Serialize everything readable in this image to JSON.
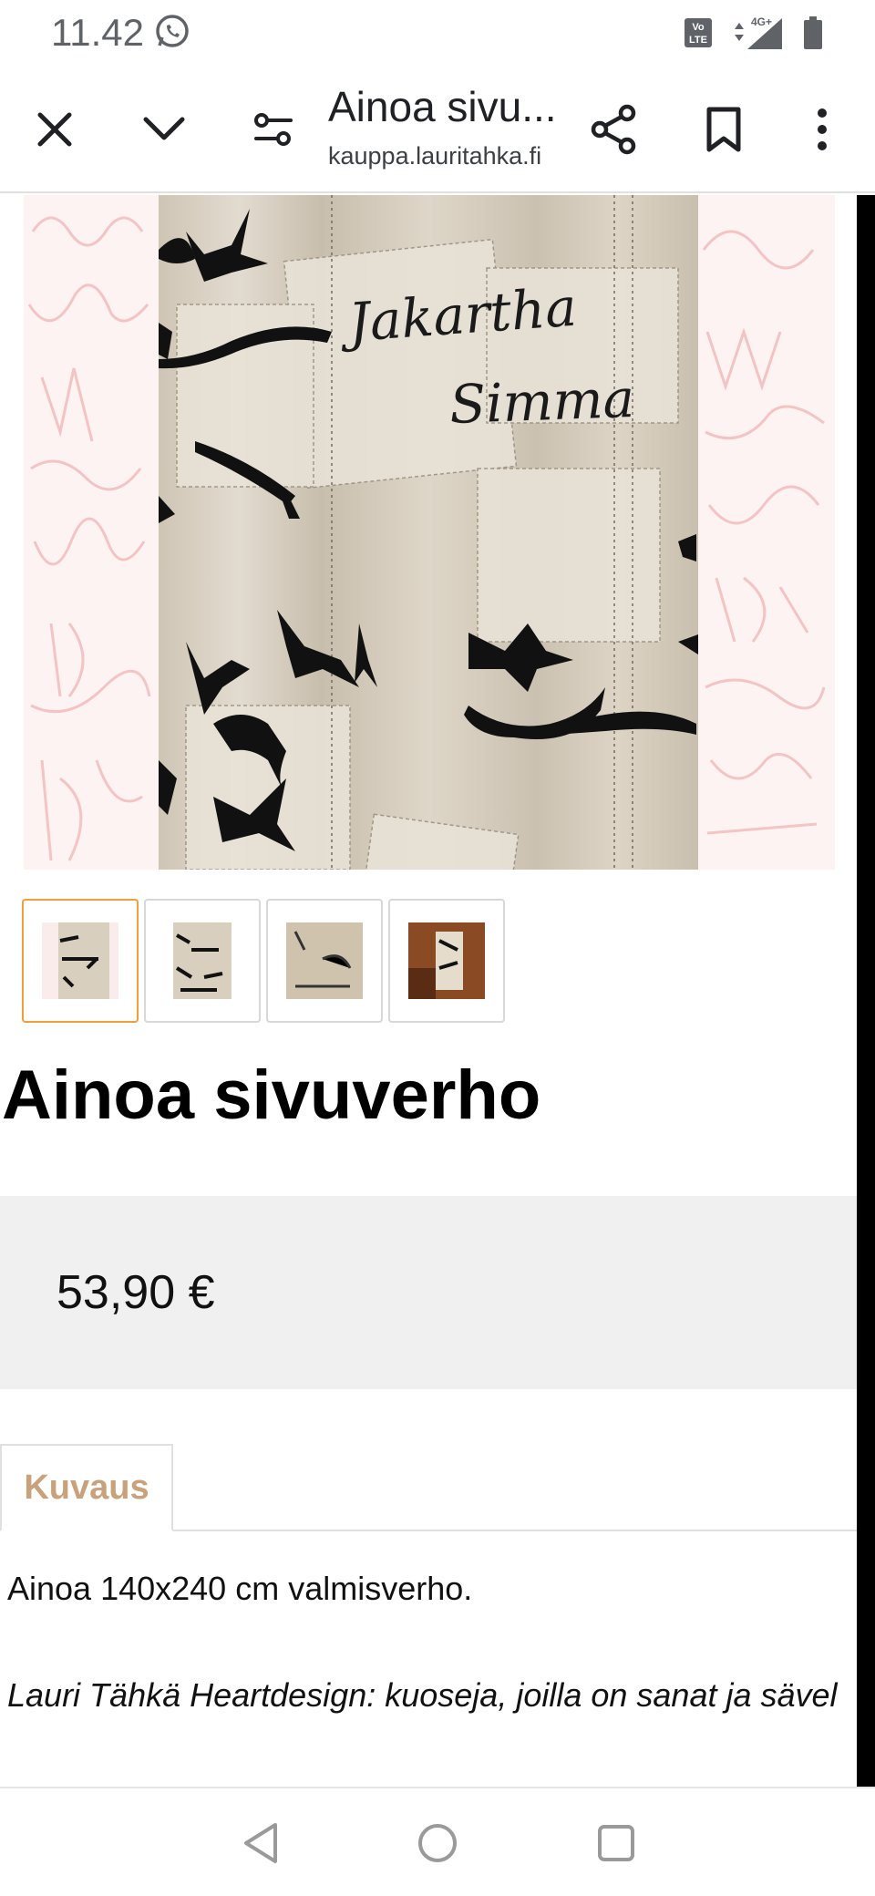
{
  "status_bar": {
    "time": "11.42",
    "icons": [
      "whatsapp-icon",
      "volte-icon",
      "data-arrows-icon",
      "signal-4g-icon",
      "battery-icon"
    ],
    "network_label": "4G+",
    "volte_label": "VoLTE"
  },
  "toolbar": {
    "title": "Ainoa sivu...",
    "url": "kauppa.lauritahka.fi",
    "icons": [
      "close-icon",
      "chevron-down-icon",
      "page-settings-icon",
      "share-icon",
      "bookmark-icon",
      "more-vert-icon"
    ]
  },
  "hero_image": {
    "description_icon": "curtain-product-image",
    "script_text_1": "Jakartha",
    "script_text_2": "Simma"
  },
  "thumbnails": [
    {
      "name": "thumb-1",
      "active": true
    },
    {
      "name": "thumb-2",
      "active": false
    },
    {
      "name": "thumb-3",
      "active": false
    },
    {
      "name": "thumb-4",
      "active": false
    }
  ],
  "product": {
    "title": "Ainoa sivuverho",
    "price": "53,90 €"
  },
  "tabs": [
    {
      "label": "Kuvaus"
    }
  ],
  "description": {
    "line1": "Ainoa 140x240 cm valmisverho.",
    "line2": "Lauri Tähkä Heartdesign: kuoseja, joilla on sanat ja sävel"
  },
  "colors": {
    "accent_tab": "#c9a27c",
    "thumb_active": "#f0a03a",
    "price_bg": "#f0f0f0",
    "fabric": "#d6ccbd"
  },
  "navbar": {
    "icons": [
      "back-triangle-icon",
      "home-circle-icon",
      "recents-square-icon"
    ]
  }
}
